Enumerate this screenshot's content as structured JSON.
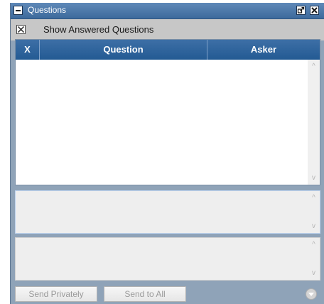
{
  "panel": {
    "title": "Questions"
  },
  "options": {
    "show_answered_label": "Show Answered Questions",
    "show_answered_checked": true
  },
  "table": {
    "columns": [
      "X",
      "Question",
      "Asker"
    ],
    "rows": []
  },
  "actions": {
    "send_privately_label": "Send Privately",
    "send_to_all_label": "Send to All"
  },
  "colors": {
    "titlebar": "#4a77a8",
    "header": "#2c63a0",
    "panel_bg": "#8fa3b8"
  },
  "icons": {
    "scroll_up": "^",
    "scroll_down": "v"
  }
}
